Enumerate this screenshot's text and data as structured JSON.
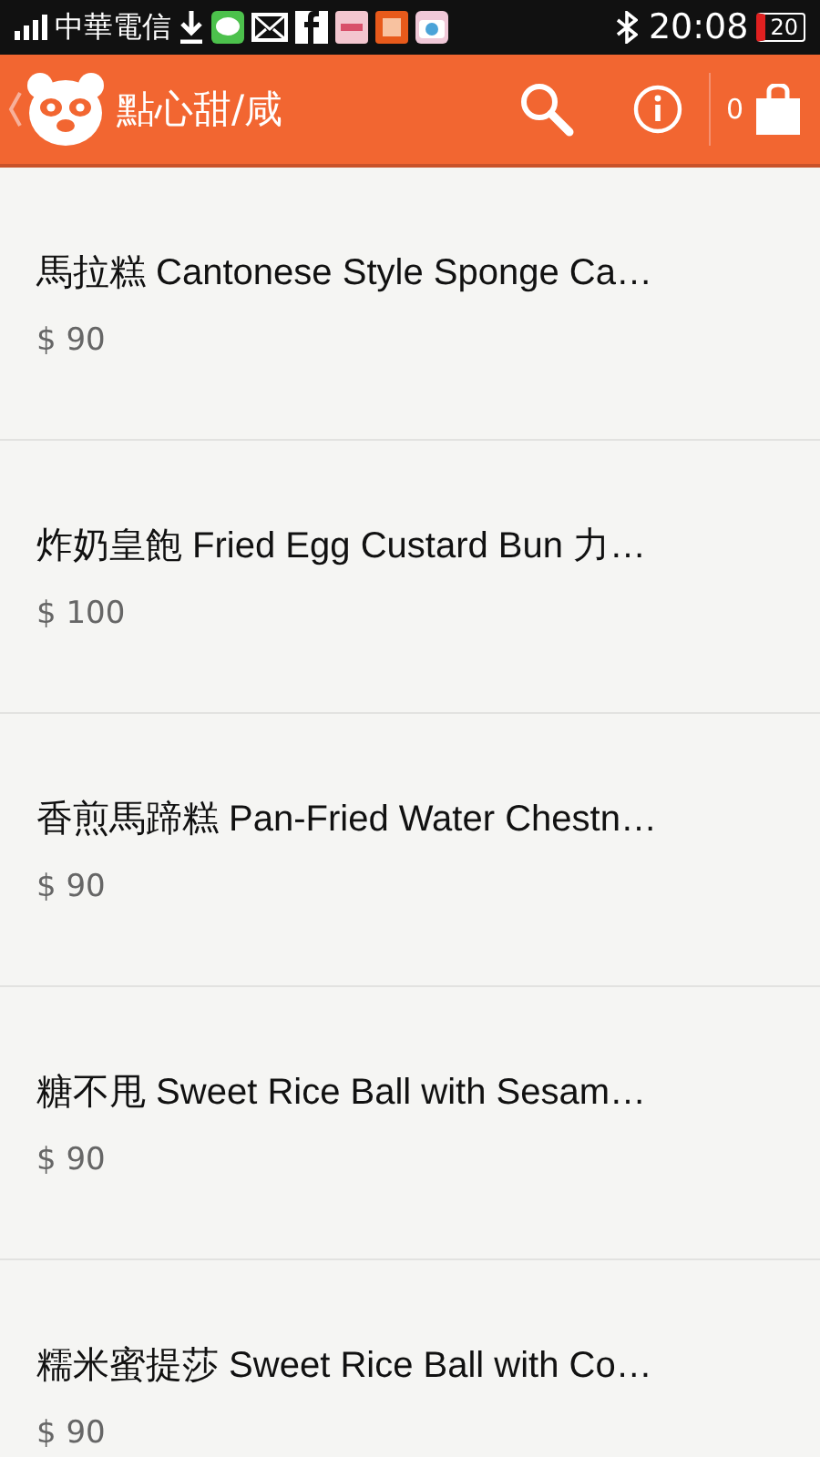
{
  "status_bar": {
    "carrier": "中華電信",
    "time": "20:08",
    "battery": "20"
  },
  "app_bar": {
    "title": "點心甜/咸",
    "cart_count": "0"
  },
  "items": [
    {
      "name": "馬拉糕 Cantonese Style Sponge Ca…",
      "price": "$ 90"
    },
    {
      "name": "炸奶皇飽 Fried Egg Custard Bun 力…",
      "price": "$ 100"
    },
    {
      "name": "香煎馬蹄糕 Pan-Fried Water Chestn…",
      "price": "$ 90"
    },
    {
      "name": "糖不甩 Sweet Rice Ball with Sesam…",
      "price": "$ 90"
    },
    {
      "name": "糯米蜜提莎  Sweet Rice Ball with Co…",
      "price": "$ 90"
    }
  ]
}
